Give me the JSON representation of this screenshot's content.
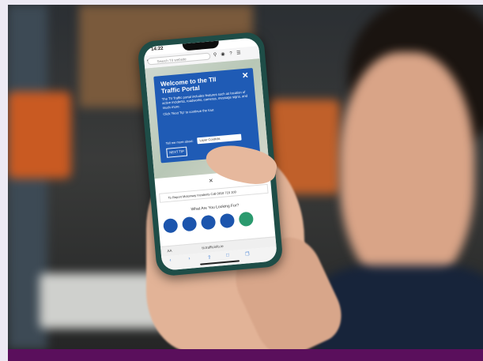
{
  "phone": {
    "status_time": "14:22",
    "search_placeholder": "Search TII website",
    "icons": [
      "location-pin-icon",
      "search-icon",
      "user-icon",
      "help-icon",
      "menu-icon"
    ],
    "popup": {
      "title": "Welcome to the TII Traffic Portal",
      "close": "✕",
      "body": "The TII Traffic portal includes features such as location of active incidents, roadworks, cameras, message signs, and much more.",
      "hint": "Click 'Next Tip' to continue the tour.",
      "tell_more": "Tell me more about:",
      "select_value": "Layer Controls",
      "next_button": "NEXT TIP"
    },
    "map_close": "✕",
    "incident_text": "To Report Motorway Incidents Call 0818 715 100",
    "looking_for": "What Are You Looking For?",
    "url_aa": "AA",
    "url": "tii.trafficinfo.ie",
    "accent": "#1f5bb5"
  },
  "colors": {
    "phone_case": "#1e4d47",
    "bottom_bar": "#5a0f5c",
    "frame": "#edeaf4"
  }
}
